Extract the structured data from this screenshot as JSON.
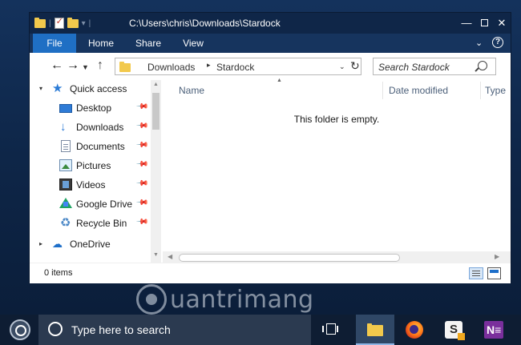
{
  "window": {
    "title": "C:\\Users\\chris\\Downloads\\Stardock",
    "qat_separator": "|",
    "qat_dropdown": "▾"
  },
  "ribbon": {
    "tabs": [
      "File",
      "Home",
      "Share",
      "View"
    ],
    "chevron": "⌄",
    "help": "?"
  },
  "address_bar": {
    "breadcrumbs": [
      "Downloads",
      "Stardock"
    ],
    "separator": "▸",
    "dropdown": "⌄",
    "refresh": "↻"
  },
  "search": {
    "placeholder": "Search Stardock"
  },
  "navigation": {
    "quick_access": "Quick access",
    "items": [
      {
        "label": "Desktop",
        "icon": "desktop-icon",
        "pinned": true
      },
      {
        "label": "Downloads",
        "icon": "downloads-icon",
        "pinned": true
      },
      {
        "label": "Documents",
        "icon": "documents-icon",
        "pinned": true
      },
      {
        "label": "Pictures",
        "icon": "pictures-icon",
        "pinned": true
      },
      {
        "label": "Videos",
        "icon": "videos-icon",
        "pinned": true
      },
      {
        "label": "Google Drive",
        "icon": "google-drive-icon",
        "pinned": true
      },
      {
        "label": "Recycle Bin",
        "icon": "recycle-bin-icon",
        "pinned": true
      }
    ],
    "onedrive": "OneDrive"
  },
  "content": {
    "columns": [
      "Name",
      "Date modified",
      "Type"
    ],
    "empty_message": "This folder is empty."
  },
  "status": {
    "item_count": "0 items"
  },
  "watermark": {
    "text": "uantrimang"
  },
  "taskbar": {
    "search_placeholder": "Type here to search",
    "apps": [
      "File Explorer",
      "Firefox",
      "Slack",
      "OneNote"
    ],
    "slack_glyph": "S",
    "onenote_glyph": "N≡"
  },
  "colors": {
    "title_bar": "#0f2648",
    "ribbon": "#16345e",
    "file_tab": "#1f6fc4",
    "taskbar": "#0e1d33",
    "accent": "#2b7bd6"
  }
}
